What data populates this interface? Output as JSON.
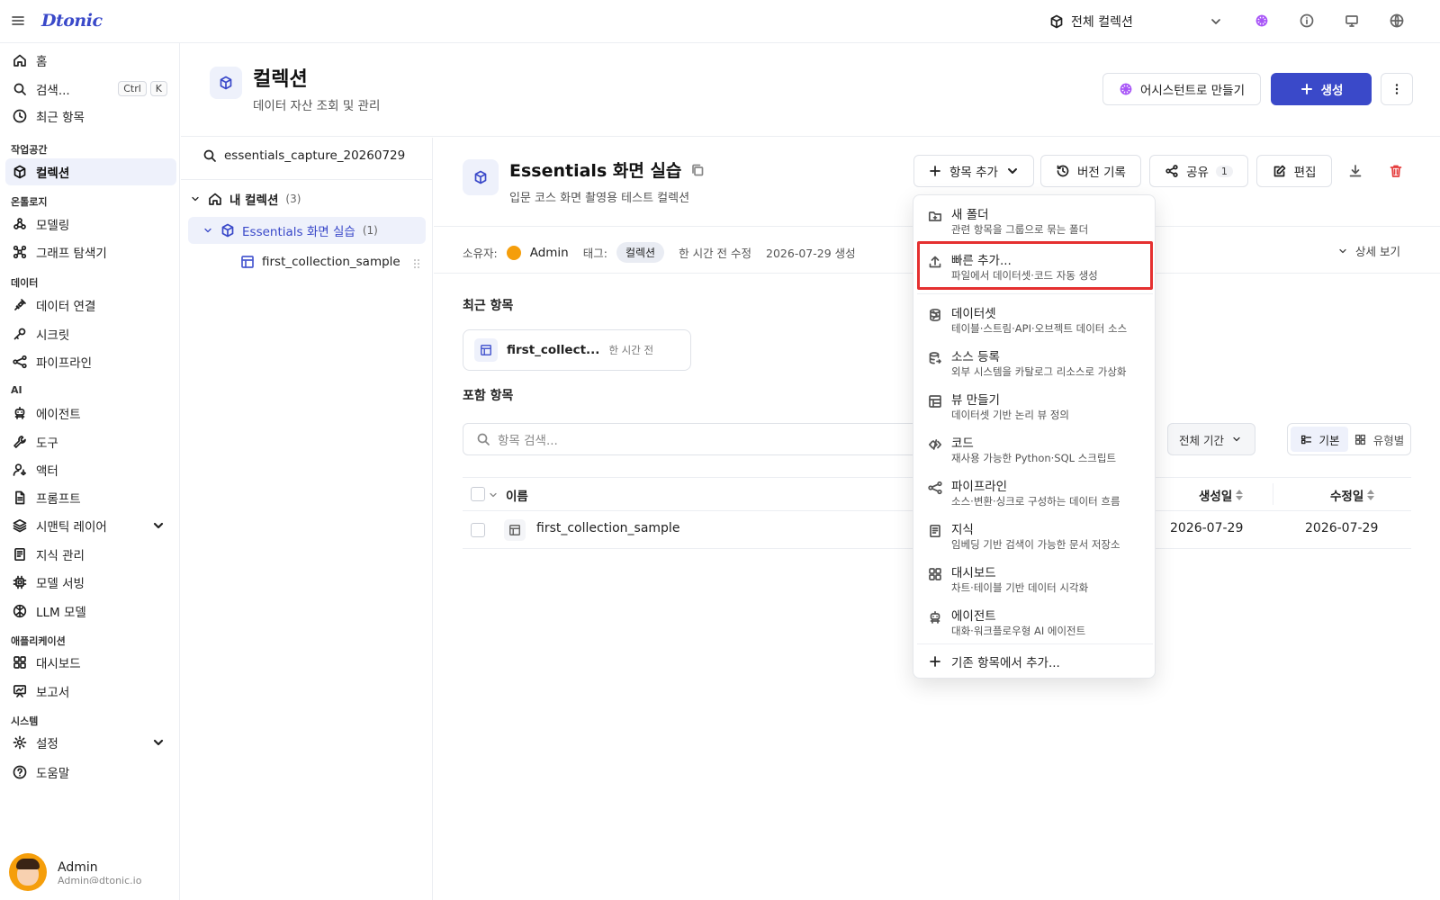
{
  "app": {
    "logo": "Dtonic",
    "scope_label": "전체 컬렉션"
  },
  "sidebar": {
    "items_top": [
      {
        "label": "홈",
        "icon": "home-icon"
      },
      {
        "label": "검색...",
        "icon": "search-icon",
        "kbd": [
          "Ctrl",
          "K"
        ]
      },
      {
        "label": "최근 항목",
        "icon": "clock-icon"
      }
    ],
    "sections": [
      {
        "label": "작업공간",
        "items": [
          {
            "label": "컬렉션",
            "icon": "cube-icon",
            "active": true
          }
        ]
      },
      {
        "label": "온톨로지",
        "items": [
          {
            "label": "모델링",
            "icon": "nodes-icon"
          },
          {
            "label": "그래프 탐색기",
            "icon": "graph-icon"
          }
        ]
      },
      {
        "label": "데이터",
        "items": [
          {
            "label": "데이터 연결",
            "icon": "plug-icon"
          },
          {
            "label": "시크릿",
            "icon": "key-icon"
          },
          {
            "label": "파이프라인",
            "icon": "pipeline-icon"
          }
        ]
      },
      {
        "label": "AI",
        "items": [
          {
            "label": "에이전트",
            "icon": "robot-icon"
          },
          {
            "label": "도구",
            "icon": "wrench-icon"
          },
          {
            "label": "액터",
            "icon": "user-gear-icon"
          },
          {
            "label": "프롬프트",
            "icon": "document-icon"
          },
          {
            "label": "시맨틱 레이어",
            "icon": "layers-icon",
            "expandable": true
          },
          {
            "label": "지식 관리",
            "icon": "book-icon"
          },
          {
            "label": "모델 서빙",
            "icon": "chip-icon"
          },
          {
            "label": "LLM 모델",
            "icon": "brain-icon"
          }
        ]
      },
      {
        "label": "애플리케이션",
        "items": [
          {
            "label": "대시보드",
            "icon": "dashboard-icon"
          },
          {
            "label": "보고서",
            "icon": "presentation-icon"
          }
        ]
      },
      {
        "label": "시스템",
        "items": [
          {
            "label": "설정",
            "icon": "gear-icon",
            "expandable": true
          },
          {
            "label": "도움말",
            "icon": "help-icon"
          }
        ]
      }
    ],
    "user": {
      "name": "Admin",
      "email": "Admin@dtonic.io"
    }
  },
  "header": {
    "title": "컬렉션",
    "subtitle": "데이터 자산 조회 및 관리",
    "assistant_button": "어시스턴트로 만들기",
    "create_button": "생성"
  },
  "tree": {
    "search_value": "essentials_capture_20260729",
    "root_label": "내 컬렉션",
    "root_count": "(3)",
    "collection_label": "Essentials 화면 실습",
    "collection_count": "(1)",
    "child_label": "first_collection_sample"
  },
  "detail": {
    "title": "Essentials 화면 실습",
    "subtitle": "입문 코스 화면 촬영용 테스트 컬렉션",
    "buttons": {
      "add": "항목 추가",
      "history": "버전 기록",
      "share": "공유",
      "share_count": "1",
      "edit": "편집"
    },
    "meta": {
      "owner_label": "소유자:",
      "owner": "Admin",
      "tag_label": "태그:",
      "tag": "컬렉션",
      "modified": "한 시간 전 수정",
      "created": "2026-07-29 생성"
    },
    "detail_toggle": "상세 보기",
    "recent_title": "최근 항목",
    "recent_item": {
      "name": "first_collect...",
      "time": "한 시간 전"
    },
    "included_title": "포함 항목",
    "search_placeholder": "항목 검색...",
    "period_filter": "전체 기간",
    "view_basic": "기본",
    "view_type": "유형별",
    "table": {
      "columns": {
        "name": "이름",
        "created": "생성일",
        "modified": "수정일"
      },
      "rows": [
        {
          "name": "first_collection_sample",
          "created": "2026-07-29",
          "modified": "2026-07-29"
        }
      ]
    }
  },
  "dropdown": {
    "items": [
      {
        "label": "새 폴더",
        "desc": "관련 항목을 그룹으로 묶는 폴더",
        "icon": "folder-plus-icon"
      },
      {
        "label": "빠른 추가...",
        "desc": "파일에서 데이터셋·코드 자동 생성",
        "icon": "upload-icon",
        "highlighted": true
      },
      {
        "label": "데이터셋",
        "desc": "테이블·스트림·API·오브젝트 데이터 소스",
        "icon": "database-icon",
        "submenu": true
      },
      {
        "label": "소스 등록",
        "desc": "외부 시스템을 카탈로그 리소스로 가상화",
        "icon": "database-link-icon"
      },
      {
        "label": "뷰 만들기",
        "desc": "데이터셋 기반 논리 뷰 정의",
        "icon": "table-view-icon"
      },
      {
        "label": "코드",
        "desc": "재사용 가능한 Python·SQL 스크립트",
        "icon": "code-icon",
        "submenu": true
      },
      {
        "label": "파이프라인",
        "desc": "소스·변환·싱크로 구성하는 데이터 흐름",
        "icon": "pipeline-icon"
      },
      {
        "label": "지식",
        "desc": "임베딩 기반 검색이 가능한 문서 저장소",
        "icon": "book-icon"
      },
      {
        "label": "대시보드",
        "desc": "차트·테이블 기반 데이터 시각화",
        "icon": "dashboard-icon"
      },
      {
        "label": "에이전트",
        "desc": "대화·워크플로우형 AI 에이전트",
        "icon": "robot-icon"
      }
    ],
    "bottom": "기존 항목에서 추가..."
  },
  "colors": {
    "accent": "#3a49c9",
    "highlight": "#e53030",
    "danger": "#e53e3e"
  }
}
